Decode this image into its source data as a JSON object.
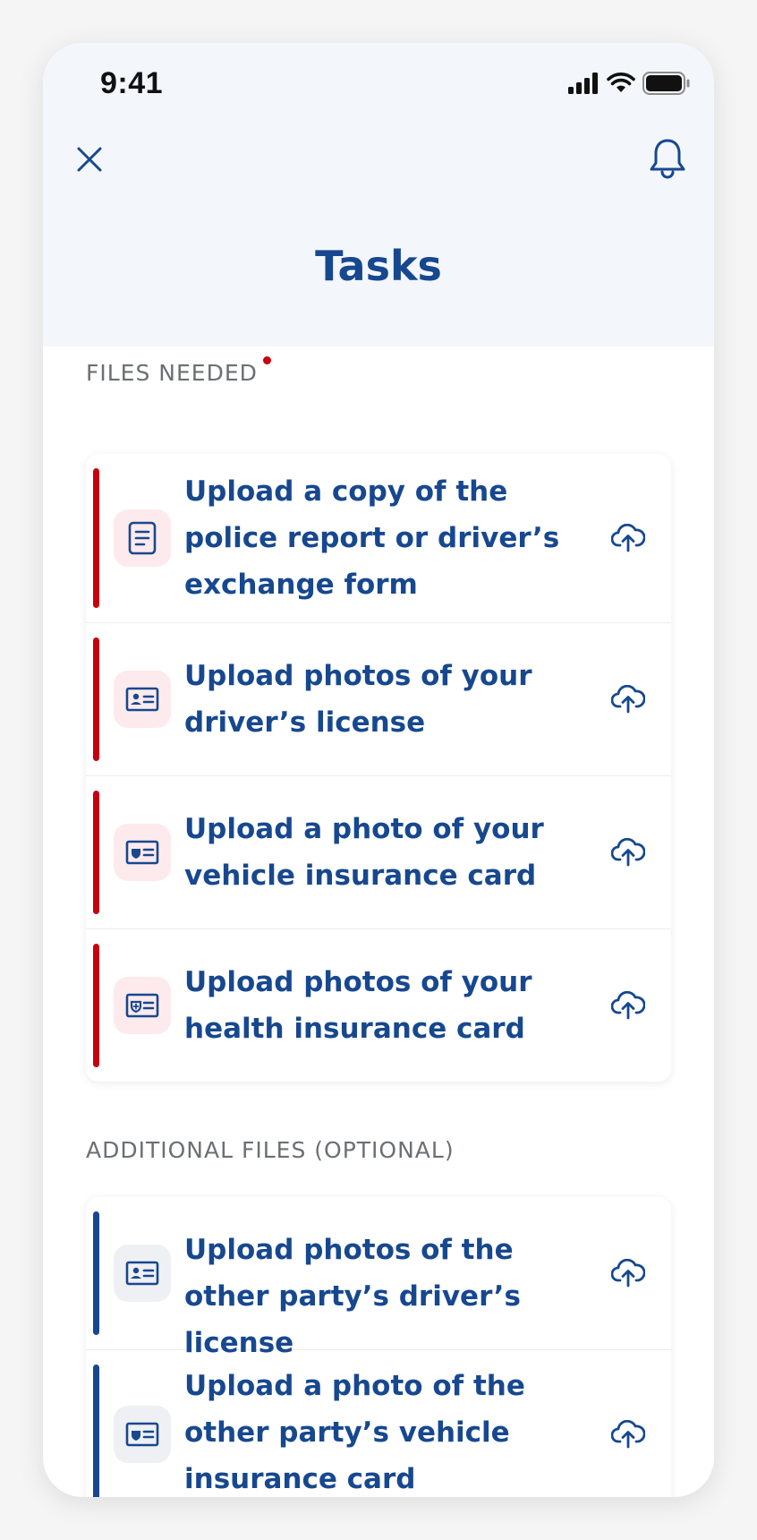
{
  "status_bar": {
    "time": "9:41",
    "icons": [
      "signal-icon",
      "wifi-icon",
      "battery-icon"
    ]
  },
  "header": {
    "title": "Tasks",
    "close_icon": "close-icon",
    "bell_icon": "bell-icon"
  },
  "sections": {
    "required": {
      "label": "FILES NEEDED",
      "items": [
        {
          "label": "Upload a copy of the police report or driver’s exchange form",
          "icon": "document-icon"
        },
        {
          "label": "Upload photos of your driver’s license",
          "icon": "id-card-icon"
        },
        {
          "label": "Upload a photo of your vehicle insurance card",
          "icon": "insurance-card-icon"
        },
        {
          "label": "Upload photos of your health insurance card",
          "icon": "health-card-icon"
        }
      ]
    },
    "optional": {
      "label": "ADDITIONAL FILES (OPTIONAL)",
      "items": [
        {
          "label": "Upload photos of the other party’s driver’s license",
          "icon": "id-card-icon"
        },
        {
          "label": "Upload a photo of the other party’s vehicle insurance card",
          "icon": "insurance-card-icon"
        }
      ]
    }
  },
  "colors": {
    "primary": "#17488f",
    "required": "#c70010",
    "header_bg": "#f3f7fc",
    "label_gray": "#6b6f75"
  }
}
